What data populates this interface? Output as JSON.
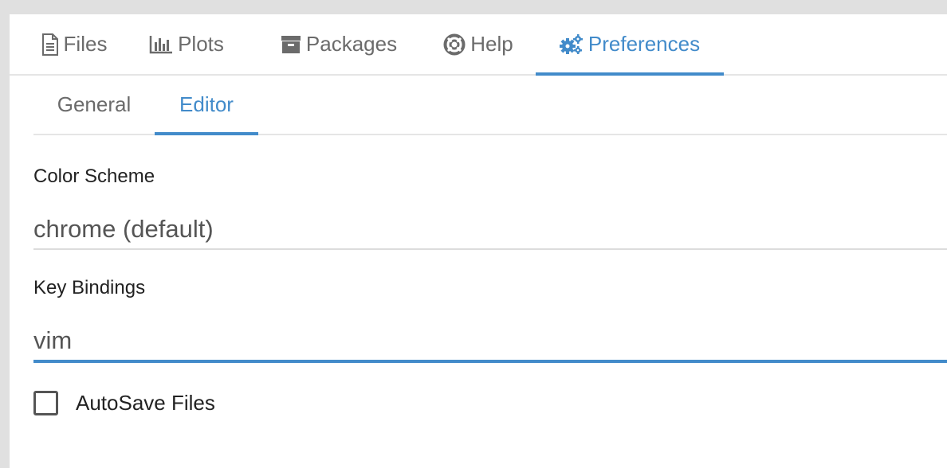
{
  "top_tabs": [
    {
      "label": "Files",
      "icon": "file-icon"
    },
    {
      "label": "Plots",
      "icon": "bar-chart-icon"
    },
    {
      "label": "Packages",
      "icon": "archive-icon"
    },
    {
      "label": "Help",
      "icon": "life-ring-icon"
    },
    {
      "label": "Preferences",
      "icon": "gears-icon",
      "active": true
    }
  ],
  "sub_tabs": [
    {
      "label": "General"
    },
    {
      "label": "Editor",
      "active": true
    }
  ],
  "editor": {
    "color_scheme_label": "Color Scheme",
    "color_scheme_value": "chrome (default)",
    "key_bindings_label": "Key Bindings",
    "key_bindings_value": "vim",
    "autosave_label": "AutoSave Files",
    "autosave_checked": false
  },
  "colors": {
    "accent": "#428bca",
    "text_muted": "#6b6b6b",
    "background_frame": "#e0e0e0"
  }
}
